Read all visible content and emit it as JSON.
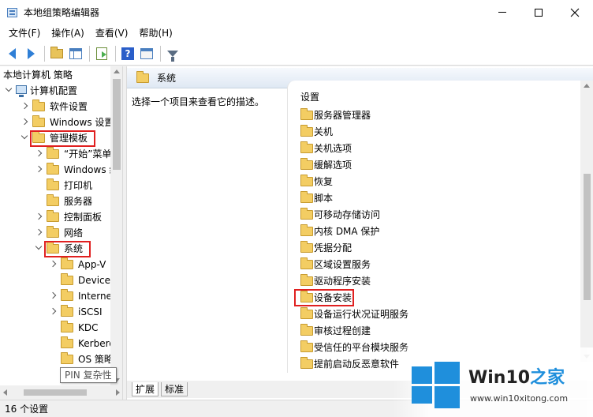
{
  "window": {
    "title": "本地组策略编辑器"
  },
  "menu": [
    "文件(F)",
    "操作(A)",
    "查看(V)",
    "帮助(H)"
  ],
  "toolbar": {
    "icons": [
      "back-arrow-icon",
      "forward-arrow-icon",
      "up-folder-icon",
      "show-hide-tree-icon",
      "export-list-icon",
      "help-icon",
      "view-icon",
      "filter-icon"
    ]
  },
  "tree": {
    "rows": [
      {
        "label": "本地计算机 策略",
        "level": 0,
        "icon": "none",
        "chevron": "none"
      },
      {
        "label": "计算机配置",
        "level": 0,
        "icon": "computer",
        "chevron": "open"
      },
      {
        "label": "软件设置",
        "level": 1,
        "icon": "folder",
        "chevron": "closed"
      },
      {
        "label": "Windows 设置",
        "level": 1,
        "icon": "folder",
        "chevron": "closed"
      },
      {
        "label": "管理模板",
        "level": 1,
        "icon": "folder",
        "chevron": "open",
        "highlight": true
      },
      {
        "label": "“开始”菜单和任",
        "level": 2,
        "icon": "folder",
        "chevron": "closed"
      },
      {
        "label": "Windows 组件",
        "level": 2,
        "icon": "folder",
        "chevron": "closed"
      },
      {
        "label": "打印机",
        "level": 2,
        "icon": "folder",
        "chevron": "none"
      },
      {
        "label": "服务器",
        "level": 2,
        "icon": "folder",
        "chevron": "none"
      },
      {
        "label": "控制面板",
        "level": 2,
        "icon": "folder",
        "chevron": "closed"
      },
      {
        "label": "网络",
        "level": 2,
        "icon": "folder",
        "chevron": "closed"
      },
      {
        "label": "系统",
        "level": 2,
        "icon": "folder",
        "chevron": "open",
        "highlight": true
      },
      {
        "label": "App-V",
        "level": 3,
        "icon": "folder",
        "chevron": "closed"
      },
      {
        "label": "Device Gu",
        "level": 3,
        "icon": "folder",
        "chevron": "none"
      },
      {
        "label": "Internet 通",
        "level": 3,
        "icon": "folder",
        "chevron": "closed"
      },
      {
        "label": "iSCSI",
        "level": 3,
        "icon": "folder",
        "chevron": "closed"
      },
      {
        "label": "KDC",
        "level": 3,
        "icon": "folder",
        "chevron": "none"
      },
      {
        "label": "Kerberos",
        "level": 3,
        "icon": "folder",
        "chevron": "none"
      },
      {
        "label": "OS 策略",
        "level": 3,
        "icon": "folder",
        "chevron": "none"
      }
    ],
    "tooltip": "PIN 复杂性"
  },
  "right": {
    "title": "系统",
    "description": "选择一个项目来查看它的描述。",
    "column_header": "设置",
    "items": [
      {
        "label": "服务器管理器"
      },
      {
        "label": "关机"
      },
      {
        "label": "关机选项"
      },
      {
        "label": "缓解选项"
      },
      {
        "label": "恢复"
      },
      {
        "label": "脚本"
      },
      {
        "label": "可移动存储访问"
      },
      {
        "label": "内核 DMA 保护"
      },
      {
        "label": "凭据分配"
      },
      {
        "label": "区域设置服务"
      },
      {
        "label": "驱动程序安装"
      },
      {
        "label": "设备安装",
        "highlight": true
      },
      {
        "label": "设备运行状况证明服务"
      },
      {
        "label": "审核过程创建"
      },
      {
        "label": "受信任的平台模块服务"
      },
      {
        "label": "提前启动反恶意软件"
      }
    ],
    "tabs": [
      "扩展",
      "标准"
    ]
  },
  "status": {
    "text": "16 个设置"
  },
  "watermark": {
    "brand_main": "Win10",
    "brand_accent": "之家",
    "url": "www.win10xitong.com"
  },
  "colors": {
    "highlight_box": "#e02020",
    "folder": "#f3cd63",
    "accent_blue": "#1f8fdc"
  }
}
